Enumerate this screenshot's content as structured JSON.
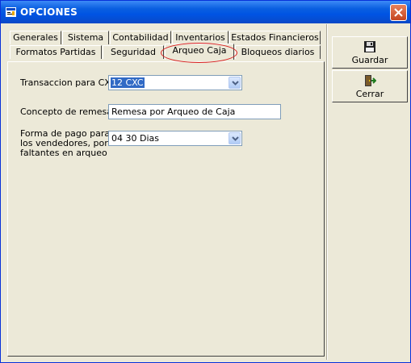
{
  "window": {
    "title": "OPCIONES",
    "title_color": "#ffffff",
    "titlebar_color": "#0054e3"
  },
  "tabs": {
    "row_back": [
      {
        "label": "Generales"
      },
      {
        "label": "Sistema"
      },
      {
        "label": "Contabilidad"
      },
      {
        "label": "Inventarios"
      },
      {
        "label": "Estados Financieros"
      }
    ],
    "row_front": [
      {
        "label": "Formatos Partidas"
      },
      {
        "label": "Seguridad"
      },
      {
        "label": "Arqueo Caja",
        "active": true
      },
      {
        "label": "Bloqueos diarios"
      }
    ],
    "highlight_color": "#d81e1e"
  },
  "form": {
    "transaccion": {
      "label": "Transaccion para CXC",
      "value": "12 CXC"
    },
    "concepto": {
      "label": "Concepto de remesas",
      "value": "Remesa por Arqueo de Caja"
    },
    "forma_pago": {
      "label_line1": "Forma de pago para",
      "label_line2": "los vendedores, por",
      "label_line3": "faltantes en arqueo",
      "value": "04 30 Dias"
    }
  },
  "sidebar": {
    "guardar": {
      "label": "Guardar",
      "icon": "floppy-disk-icon"
    },
    "cerrar": {
      "label": "Cerrar",
      "icon": "exit-door-icon"
    }
  }
}
